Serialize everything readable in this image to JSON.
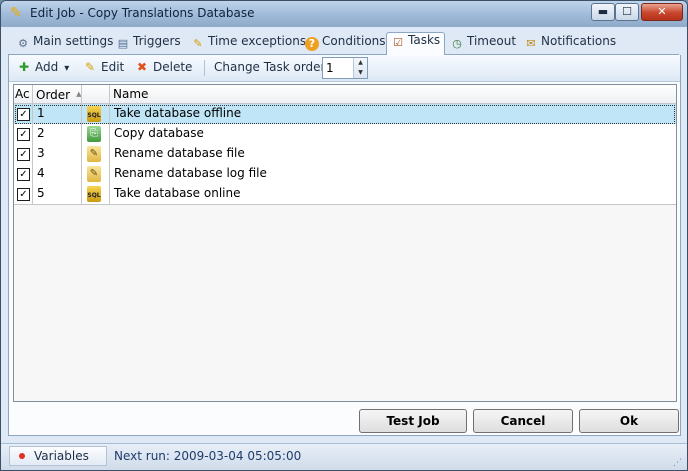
{
  "window": {
    "title": "Edit Job - Copy Translations Database",
    "controls": {
      "minimize": "▬",
      "maximize": "☐",
      "close": "✕"
    }
  },
  "tabs": [
    {
      "label": "Main settings",
      "icon": "gears-icon",
      "glyph": "⚙"
    },
    {
      "label": "Triggers",
      "icon": "calendar-icon",
      "glyph": "▤"
    },
    {
      "label": "Time exceptions",
      "icon": "pencil-icon",
      "glyph": "✎"
    },
    {
      "label": "Conditions",
      "icon": "help-icon",
      "glyph": "?"
    },
    {
      "label": "Tasks",
      "icon": "clipboard-icon",
      "glyph": "☑"
    },
    {
      "label": "Timeout",
      "icon": "clock-icon",
      "glyph": "◷"
    },
    {
      "label": "Notifications",
      "icon": "envelope-icon",
      "glyph": "✉"
    }
  ],
  "active_tab": "Tasks",
  "toolbar": {
    "add": {
      "label": "Add",
      "icon": "plus-icon",
      "glyph": "✚",
      "dropdown": "▾"
    },
    "edit": {
      "label": "Edit",
      "icon": "pencil-icon",
      "glyph": "✎"
    },
    "delete": {
      "label": "Delete",
      "icon": "delete-x-icon",
      "glyph": "✖"
    },
    "change_order_label": "Change Task order:",
    "order_value": "1",
    "spin_up": "▲",
    "spin_down": "▼"
  },
  "grid": {
    "columns": [
      "Ac",
      "Order",
      "",
      "Name"
    ],
    "sort_indicator": "▲",
    "rows": [
      {
        "active": true,
        "check": "✓",
        "order": "1",
        "icon": "sql",
        "icon_text": "SQL",
        "name": "Take database offline",
        "selected": true
      },
      {
        "active": true,
        "check": "✓",
        "order": "2",
        "icon": "copy",
        "icon_text": "⎘",
        "name": "Copy database",
        "selected": false
      },
      {
        "active": true,
        "check": "✓",
        "order": "3",
        "icon": "ren",
        "icon_text": "✎",
        "name": "Rename database file",
        "selected": false
      },
      {
        "active": true,
        "check": "✓",
        "order": "4",
        "icon": "ren",
        "icon_text": "✎",
        "name": "Rename database log file",
        "selected": false
      },
      {
        "active": true,
        "check": "✓",
        "order": "5",
        "icon": "sql",
        "icon_text": "SQL",
        "name": "Take database online",
        "selected": false
      }
    ]
  },
  "buttons": {
    "test_job": "Test Job",
    "cancel": "Cancel",
    "ok": "Ok"
  },
  "status": {
    "variables": "Variables",
    "next_run": "Next run: 2009-03-04 05:05:00",
    "grip": "⋰"
  },
  "colors": {
    "selected_row": "#bfe5f6",
    "accent": "#8ca6c4"
  }
}
